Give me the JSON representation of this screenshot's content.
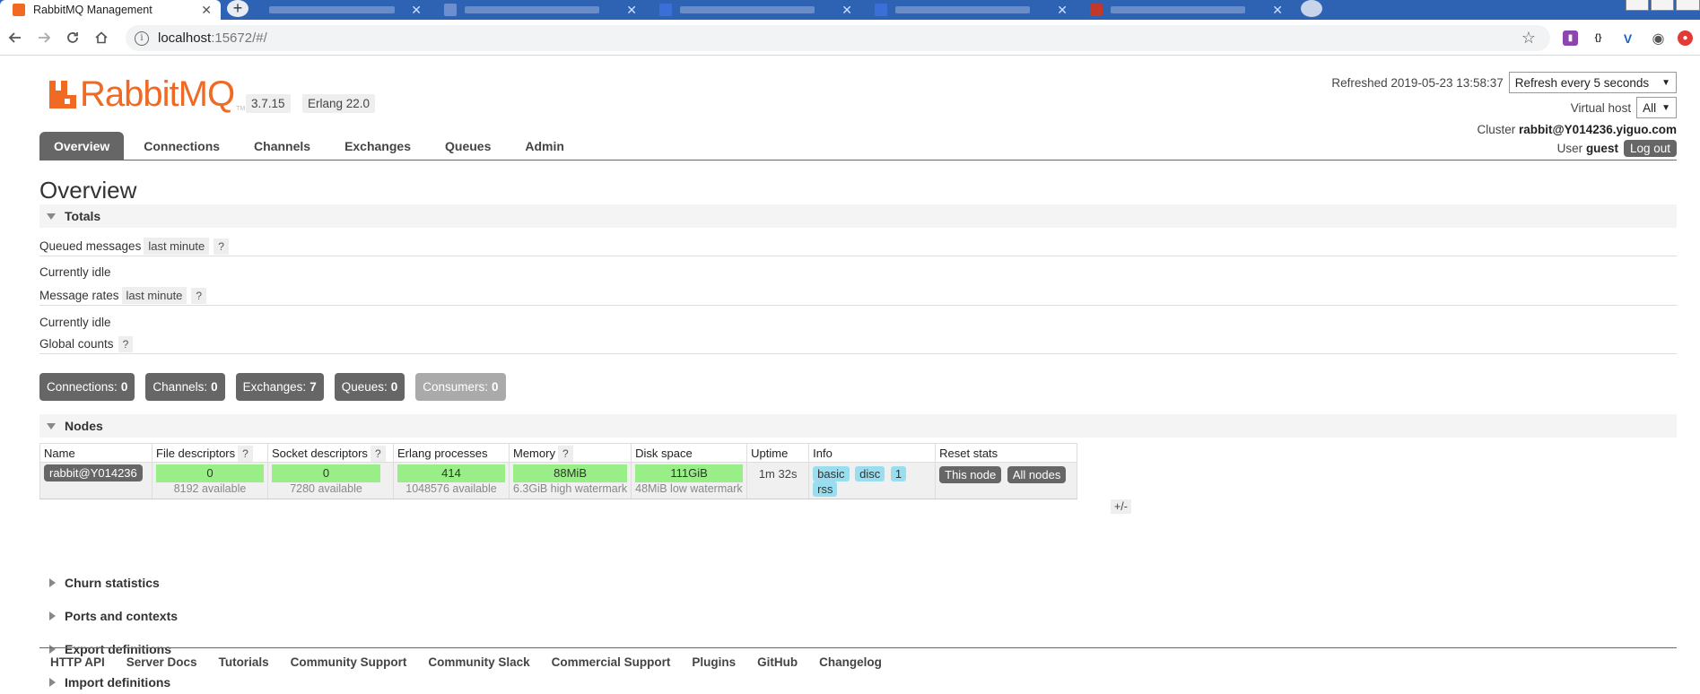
{
  "browser": {
    "active_tab": {
      "title": "RabbitMQ Management",
      "close": "✕"
    },
    "new_tab": "+",
    "url_host": "localhost",
    "url_rest": ":15672/#/",
    "inactive_tabs": [
      {
        "close": "✕",
        "favicon_color": "#6d8fd0"
      },
      {
        "close": "✕",
        "favicon_color": "#3a6fd8"
      },
      {
        "close": "✕",
        "favicon_color": "#3a6fd8"
      },
      {
        "close": "✕",
        "favicon_color": "#3a6fd8"
      },
      {
        "close": "✕",
        "favicon_color": "#c0392b"
      }
    ]
  },
  "header": {
    "logo_text": "RabbitMQ",
    "logo_tm": "TM",
    "version": "3.7.15",
    "erlang": "Erlang 22.0",
    "refreshed_label": "Refreshed",
    "refreshed_time": "2019-05-23 13:58:37",
    "refresh_select": "Refresh every 5 seconds",
    "vhost_label": "Virtual host",
    "vhost_select": "All",
    "cluster_label": "Cluster",
    "cluster_name": "rabbit@Y014236.yiguo.com",
    "user_label": "User",
    "user_name": "guest",
    "logout": "Log out"
  },
  "nav": [
    {
      "label": "Overview",
      "active": true
    },
    {
      "label": "Connections"
    },
    {
      "label": "Channels"
    },
    {
      "label": "Exchanges"
    },
    {
      "label": "Queues"
    },
    {
      "label": "Admin"
    }
  ],
  "page_title": "Overview",
  "totals": {
    "section_title": "Totals",
    "queued_label": "Queued messages",
    "queued_tag": "last minute",
    "help": "?",
    "queued_idle": "Currently idle",
    "rates_label": "Message rates",
    "rates_tag": "last minute",
    "rates_idle": "Currently idle",
    "global_label": "Global counts"
  },
  "counts": [
    {
      "label": "Connections:",
      "value": "0"
    },
    {
      "label": "Channels:",
      "value": "0"
    },
    {
      "label": "Exchanges:",
      "value": "7"
    },
    {
      "label": "Queues:",
      "value": "0"
    },
    {
      "label": "Consumers:",
      "value": "0",
      "dim": true
    }
  ],
  "nodes": {
    "section_title": "Nodes",
    "plus_minus": "+/-",
    "headers": {
      "name": "Name",
      "fd": "File descriptors",
      "sd": "Socket descriptors",
      "ep": "Erlang processes",
      "mem": "Memory",
      "disk": "Disk space",
      "uptime": "Uptime",
      "info": "Info",
      "reset": "Reset stats"
    },
    "row": {
      "name": "rabbit@Y014236",
      "fd_value": "0",
      "fd_available": "8192 available",
      "sd_value": "0",
      "sd_available": "7280 available",
      "ep_value": "414",
      "ep_available": "1048576 available",
      "mem_value": "88MiB",
      "mem_watermark": "6.3GiB high watermark",
      "disk_value": "111GiB",
      "disk_watermark": "48MiB low watermark",
      "uptime": "1m 32s",
      "info_badges": [
        "basic",
        "disc",
        "1",
        "rss"
      ],
      "reset_this": "This node",
      "reset_all": "All nodes"
    }
  },
  "collapsed_sections": [
    "Churn statistics",
    "Ports and contexts",
    "Export definitions",
    "Import definitions"
  ],
  "footer_links": [
    "HTTP API",
    "Server Docs",
    "Tutorials",
    "Community Support",
    "Community Slack",
    "Commercial Support",
    "Plugins",
    "GitHub",
    "Changelog"
  ],
  "colors": {
    "brand_orange": "#f06a23",
    "tab_dark": "#666666",
    "green_bar": "#99ee88",
    "info_badge": "#99ddee",
    "chrome_blue": "#2e62b3"
  }
}
